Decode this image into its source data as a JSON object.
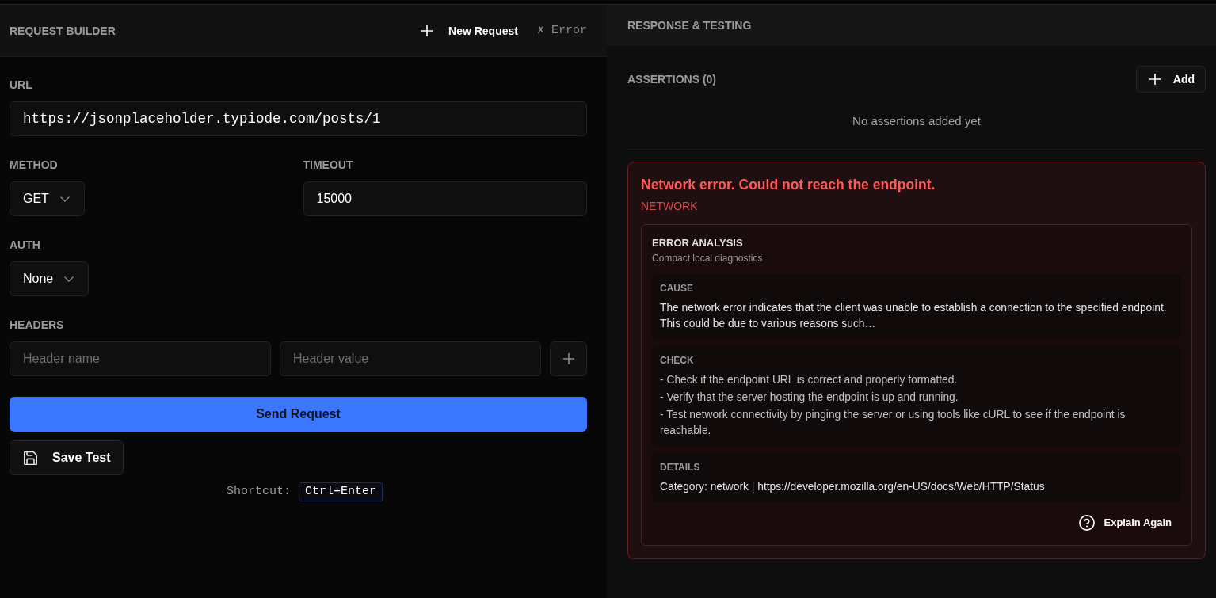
{
  "request_builder": {
    "title": "REQUEST BUILDER",
    "new_request": "New Request",
    "status": "✗ Error",
    "url": {
      "label": "URL",
      "value": "https://jsonplaceholder.typiode.com/posts/1"
    },
    "method": {
      "label": "METHOD",
      "value": "GET"
    },
    "timeout": {
      "label": "TIMEOUT",
      "value": "15000"
    },
    "auth": {
      "label": "AUTH",
      "value": "None"
    },
    "headers": {
      "label": "HEADERS",
      "fields": [
        {
          "placeholder": "Header name"
        },
        {
          "placeholder": "Header value"
        }
      ]
    },
    "send_button": "Send Request",
    "save_button": "Save Test",
    "shortcut": {
      "label": "Shortcut:",
      "keys": "Ctrl+Enter"
    }
  },
  "response_testing": {
    "title": "RESPONSE & TESTING",
    "assertions": {
      "title": "ASSERTIONS (0)",
      "add_button": "Add",
      "empty_text": "No assertions added yet"
    },
    "error": {
      "message": "Network error. Could not reach the endpoint.",
      "category": "NETWORK",
      "analysis": {
        "title": "ERROR ANALYSIS",
        "subtitle": "Compact local diagnostics",
        "sections": [
          {
            "heading": "CAUSE",
            "kind": "text",
            "lines": [
              "The network error indicates that the client was unable to establish a connection to the specified endpoint. This could be due to various reasons such…"
            ]
          },
          {
            "heading": "CHECK",
            "kind": "list",
            "lines": [
              "- Check if the endpoint URL is correct and properly formatted.",
              "- Verify that the server hosting the endpoint is up and running.",
              "- Test network connectivity by pinging the server or using tools like cURL to see if the endpoint is reachable."
            ]
          },
          {
            "heading": "DETAILS",
            "kind": "text",
            "lines": [
              "Category: network | https://developer.mozilla.org/en-US/docs/Web/HTTP/Status"
            ]
          }
        ],
        "explain_button": "Explain Again"
      }
    }
  }
}
